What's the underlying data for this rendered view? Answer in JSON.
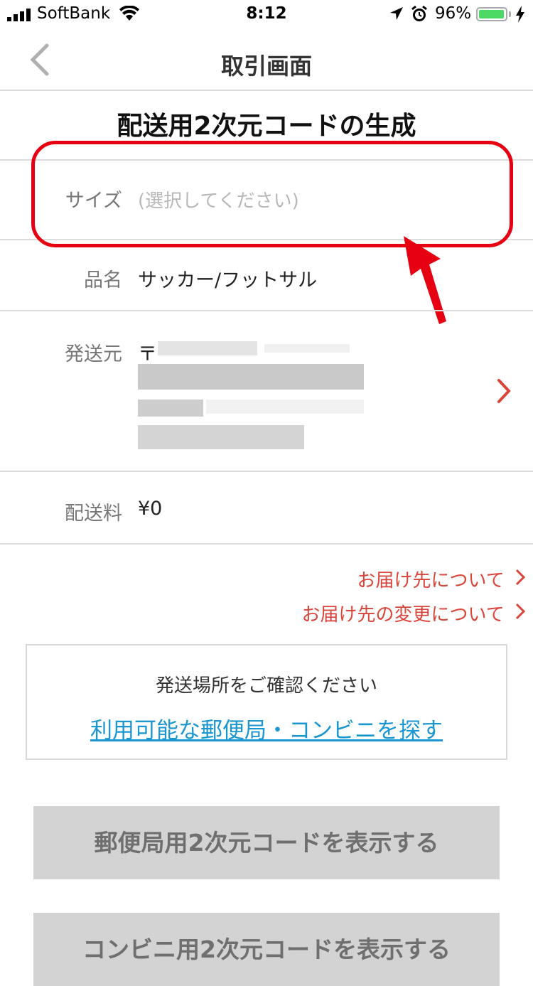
{
  "status_bar": {
    "carrier": "SoftBank",
    "time": "8:12",
    "battery_percent": "96%",
    "battery_level": 0.96,
    "icons": [
      "signal-icon",
      "wifi-icon",
      "location-icon",
      "alarm-icon",
      "battery-icon",
      "charging-icon"
    ]
  },
  "nav": {
    "title": "取引画面",
    "back_icon": "chevron-left-icon"
  },
  "section_title": "配送用2次元コードの生成",
  "form": {
    "size_label": "サイズ",
    "size_placeholder": "(選択してください)",
    "item_label": "品名",
    "item_value": "サッカー/フットサル",
    "sender_label": "発送元",
    "sender_postal_prefix": "〒",
    "shipping_fee_label": "配送料",
    "shipping_fee_value": "¥0"
  },
  "links": {
    "about_destination": "お届け先について",
    "change_destination": "お届け先の変更について"
  },
  "confirm_box": {
    "message": "発送場所をご確認ください",
    "link": "利用可能な郵便局・コンビニを探す"
  },
  "buttons": {
    "post_office_code": "郵便局用2次元コードを表示する",
    "convenience_code": "コンビニ用2次元コードを表示する"
  },
  "colors": {
    "accent_red": "#d9453a",
    "highlight_red": "#e60012",
    "link_blue": "#1a96d0",
    "button_gray": "#d3d3d3"
  }
}
